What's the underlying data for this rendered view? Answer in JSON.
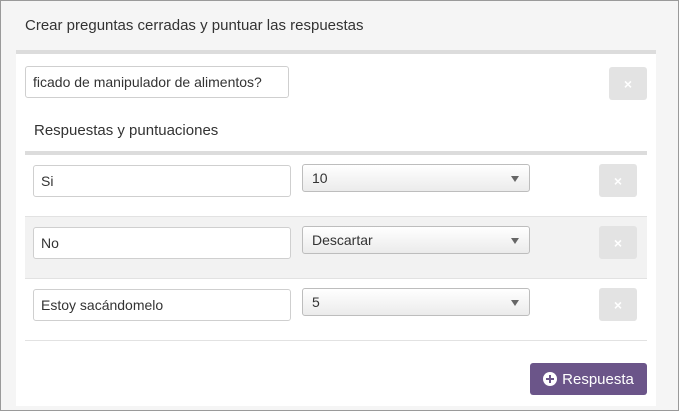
{
  "header": {
    "title": "Crear preguntas cerradas y puntuar las respuestas"
  },
  "question": {
    "value": "ficado de manipulador de alimentos?",
    "delete_icon": "×"
  },
  "answers_section": {
    "title": "Respuestas y puntuaciones"
  },
  "answers": [
    {
      "text": "Si",
      "score": "10",
      "delete_icon": "×"
    },
    {
      "text": "No",
      "score": "Descartar",
      "delete_icon": "×"
    },
    {
      "text": "Estoy sacándomelo",
      "score": "5",
      "delete_icon": "×"
    }
  ],
  "add_button": {
    "label": "Respuesta",
    "icon": "plus-circle-icon"
  },
  "colors": {
    "accent": "#6b5589",
    "delete_button": "#e3e3e3"
  }
}
